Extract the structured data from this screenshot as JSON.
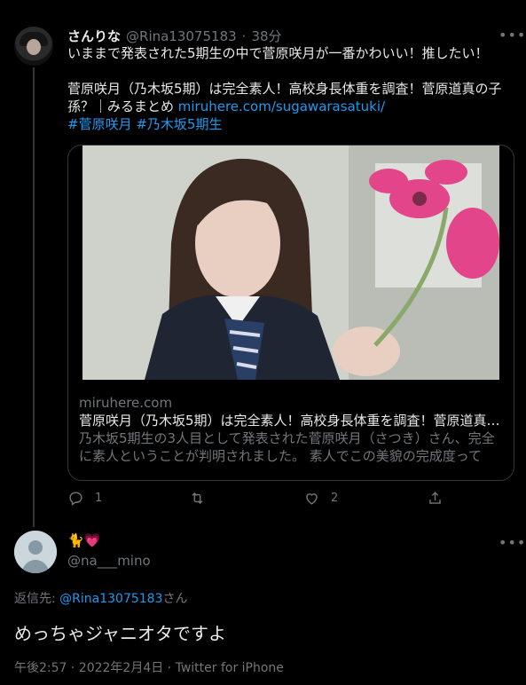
{
  "tweet": {
    "display_name": "さんりな",
    "handle": "@Rina13075183",
    "separator": "·",
    "time_ago": "38分",
    "text_line1": "いままで発表された5期生の中で菅原咲月が一番かわいい！推したい！",
    "text_line2a": "菅原咲月（乃木坂5期）は完全素人！高校身長体重を調査！菅原道真の子",
    "text_line2b": "孫？｜みるまとめ ",
    "link": "miruhere.com/sugawarasatuki/",
    "hashtag1": "#菅原咲月",
    "hashtag2": "#乃木坂5期生",
    "more_icon": "more-dots-icon",
    "card": {
      "domain": "miruhere.com",
      "title": "菅原咲月（乃木坂5期）は完全素人！高校身長体重を調査！菅原道真…",
      "description": "乃木坂5期生の3人目として発表された菅原咲月（さつき）さん、完全に素人ということが判明されました。 素人でこの美貌の完成度ってす…"
    },
    "actions": {
      "reply_count": "1",
      "retweet_count": "",
      "like_count": "2"
    }
  },
  "reply": {
    "display_name_emoji": "🐈💗",
    "handle": "@na___mino",
    "replying_to_prefix": "返信先: ",
    "replying_to_handle": "@Rina13075183",
    "replying_to_suffix": "さん",
    "text": "めっちゃジャニオタですよ",
    "timestamp": "午後2:57 · 2022年2月4日 · Twitter for iPhone"
  },
  "colors": {
    "background": "#000000",
    "text": "#e7e9ea",
    "muted": "#71767b",
    "link": "#1d9bf0",
    "border": "#333639"
  }
}
